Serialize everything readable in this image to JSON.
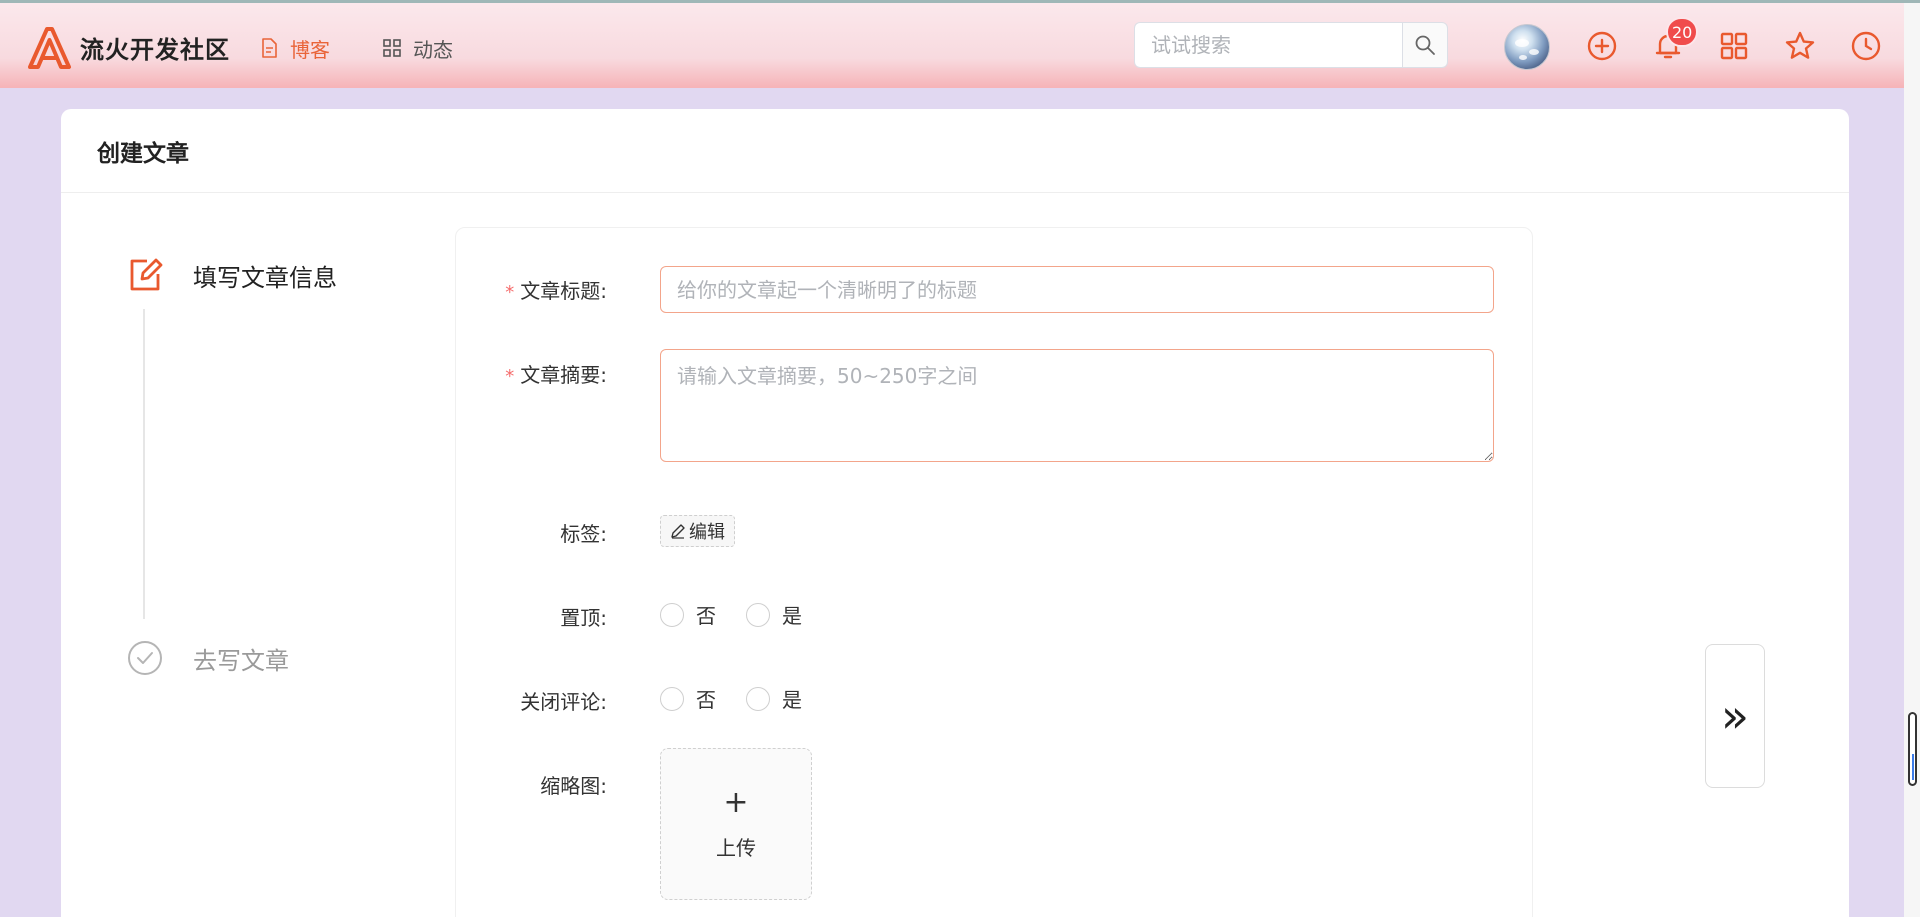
{
  "site": {
    "name": "流火开发社区",
    "brand_color": "#e9592e"
  },
  "nav": {
    "items": [
      {
        "label": "博客",
        "icon": "document-icon",
        "active": true
      },
      {
        "label": "动态",
        "icon": "grid-icon",
        "active": false
      }
    ]
  },
  "search": {
    "placeholder": "试试搜索",
    "value": ""
  },
  "header_actions": {
    "notifications_count": "20",
    "icons": [
      "avatar",
      "add-circle-icon",
      "bell-icon",
      "apps-grid-icon",
      "star-icon",
      "clock-icon"
    ]
  },
  "page": {
    "title": "创建文章"
  },
  "steps": [
    {
      "label": "填写文章信息",
      "status": "active",
      "icon": "edit-icon"
    },
    {
      "label": "去写文章",
      "status": "pending",
      "icon": "check-circle-icon"
    }
  ],
  "form": {
    "title_label": "文章标题:",
    "title_placeholder": "给你的文章起一个清晰明了的标题",
    "title_value": "",
    "summary_label": "文章摘要:",
    "summary_placeholder": "请输入文章摘要，50~250字之间",
    "summary_value": "",
    "tags_label": "标签:",
    "tags_edit_label": "编辑",
    "pin_label": "置顶:",
    "pin_options": [
      "否",
      "是"
    ],
    "close_comments_label": "关闭评论:",
    "close_comments_options": [
      "否",
      "是"
    ],
    "thumbnail_label": "缩略图:",
    "upload_plus": "+",
    "upload_label": "上传",
    "required_mark": "*"
  },
  "next_button": {
    "label": "»"
  }
}
